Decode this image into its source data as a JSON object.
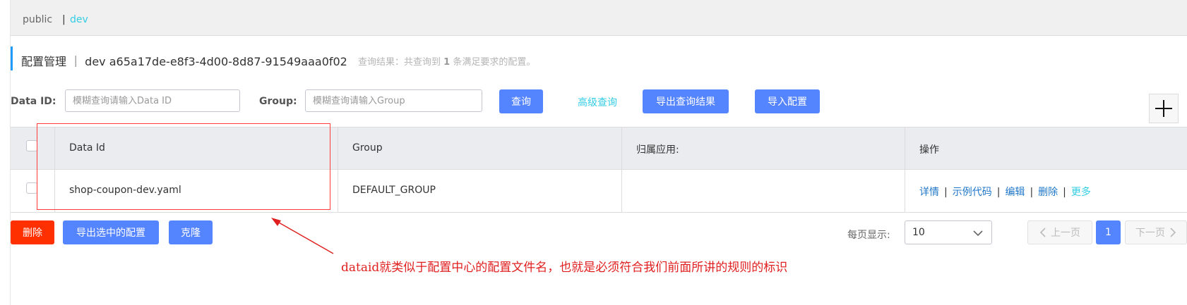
{
  "namespaces": {
    "items": [
      "public",
      "dev"
    ],
    "separator": "|"
  },
  "header": {
    "title": "配置管理 ｜ dev  a65a17de-e8f3-4d00-8d87-91549aaa0f02",
    "result_prefix": "查询结果：共查询到 ",
    "result_count": "1",
    "result_suffix": " 条满足要求的配置。"
  },
  "search": {
    "data_id_label": "Data ID:",
    "data_id_placeholder": "模糊查询请输入Data ID",
    "data_id_value": "",
    "group_label": "Group:",
    "group_placeholder": "模糊查询请输入Group",
    "group_value": "",
    "query_button": "查询",
    "advanced_link": "高级查询",
    "export_results_button": "导出查询结果",
    "import_button": "导入配置",
    "add_icon": "plus-icon"
  },
  "table": {
    "columns": [
      "Data Id",
      "Group",
      "归属应用:",
      "操作"
    ],
    "rows": [
      {
        "data_id": "shop-coupon-dev.yaml",
        "group": "DEFAULT_GROUP",
        "app": "",
        "actions": [
          "详情",
          "示例代码",
          "编辑",
          "删除",
          "更多"
        ]
      }
    ],
    "action_separator": "|"
  },
  "footer": {
    "delete_button": "删除",
    "export_selected_button": "导出选中的配置",
    "clone_button": "克隆",
    "page_size_label": "每页显示:",
    "page_size_value": "10",
    "prev_label": "上一页",
    "current_page": "1",
    "next_label": "下一页"
  },
  "annotation": {
    "text": "dataid就类似于配置中心的配置文件名，也就是必须符合我们前面所讲的规则的标识",
    "color": "#e02020"
  },
  "colors": {
    "primary_button": "#5584ff",
    "danger_button": "#ff3000",
    "link": "#2077c9",
    "accent_cyan": "#33cde5",
    "title_accent": "#209bfa"
  }
}
